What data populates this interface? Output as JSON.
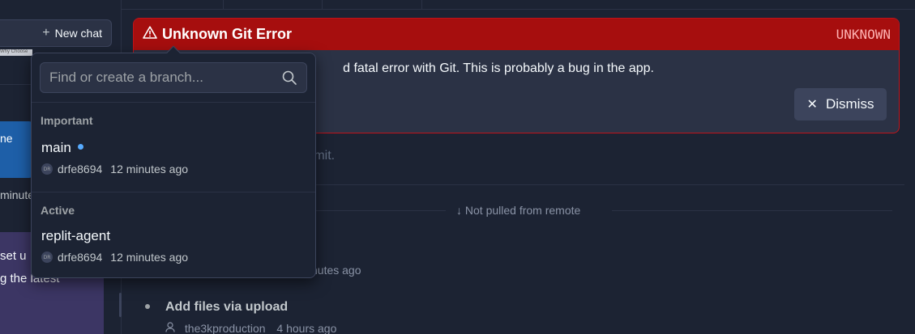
{
  "sidebar": {
    "new_chat_label": "New chat",
    "thumbnail_text": "Why Choose",
    "card_blue_text": "ne",
    "minute_text": "minute",
    "card_purple_line1": "set u",
    "card_purple_line2": "g the latest"
  },
  "error": {
    "title": "Unknown Git Error",
    "code": "UNKNOWN",
    "message": "d fatal error with Git. This is probably a bug in the app.",
    "dismiss_label": "Dismiss"
  },
  "history": {
    "commit_hint": "mmit.",
    "remote_label": "Not pulled from remote",
    "time_partial": "nutes ago",
    "commit_title": "Add files via upload",
    "commit_author": "the3kproduction",
    "commit_time": "4 hours ago"
  },
  "branch_popover": {
    "search_placeholder": "Find or create a branch...",
    "sections": [
      {
        "label": "Important",
        "branches": [
          {
            "name": "main",
            "avatar": "DR",
            "author": "drfe8694",
            "time": "12 minutes ago",
            "current": true
          }
        ]
      },
      {
        "label": "Active",
        "branches": [
          {
            "name": "replit-agent",
            "avatar": "DR",
            "author": "drfe8694",
            "time": "12 minutes ago",
            "current": false
          }
        ]
      }
    ]
  },
  "colors": {
    "error_header": "#a60e0e",
    "current_branch_dot": "#57abff",
    "background": "#1c2333"
  }
}
